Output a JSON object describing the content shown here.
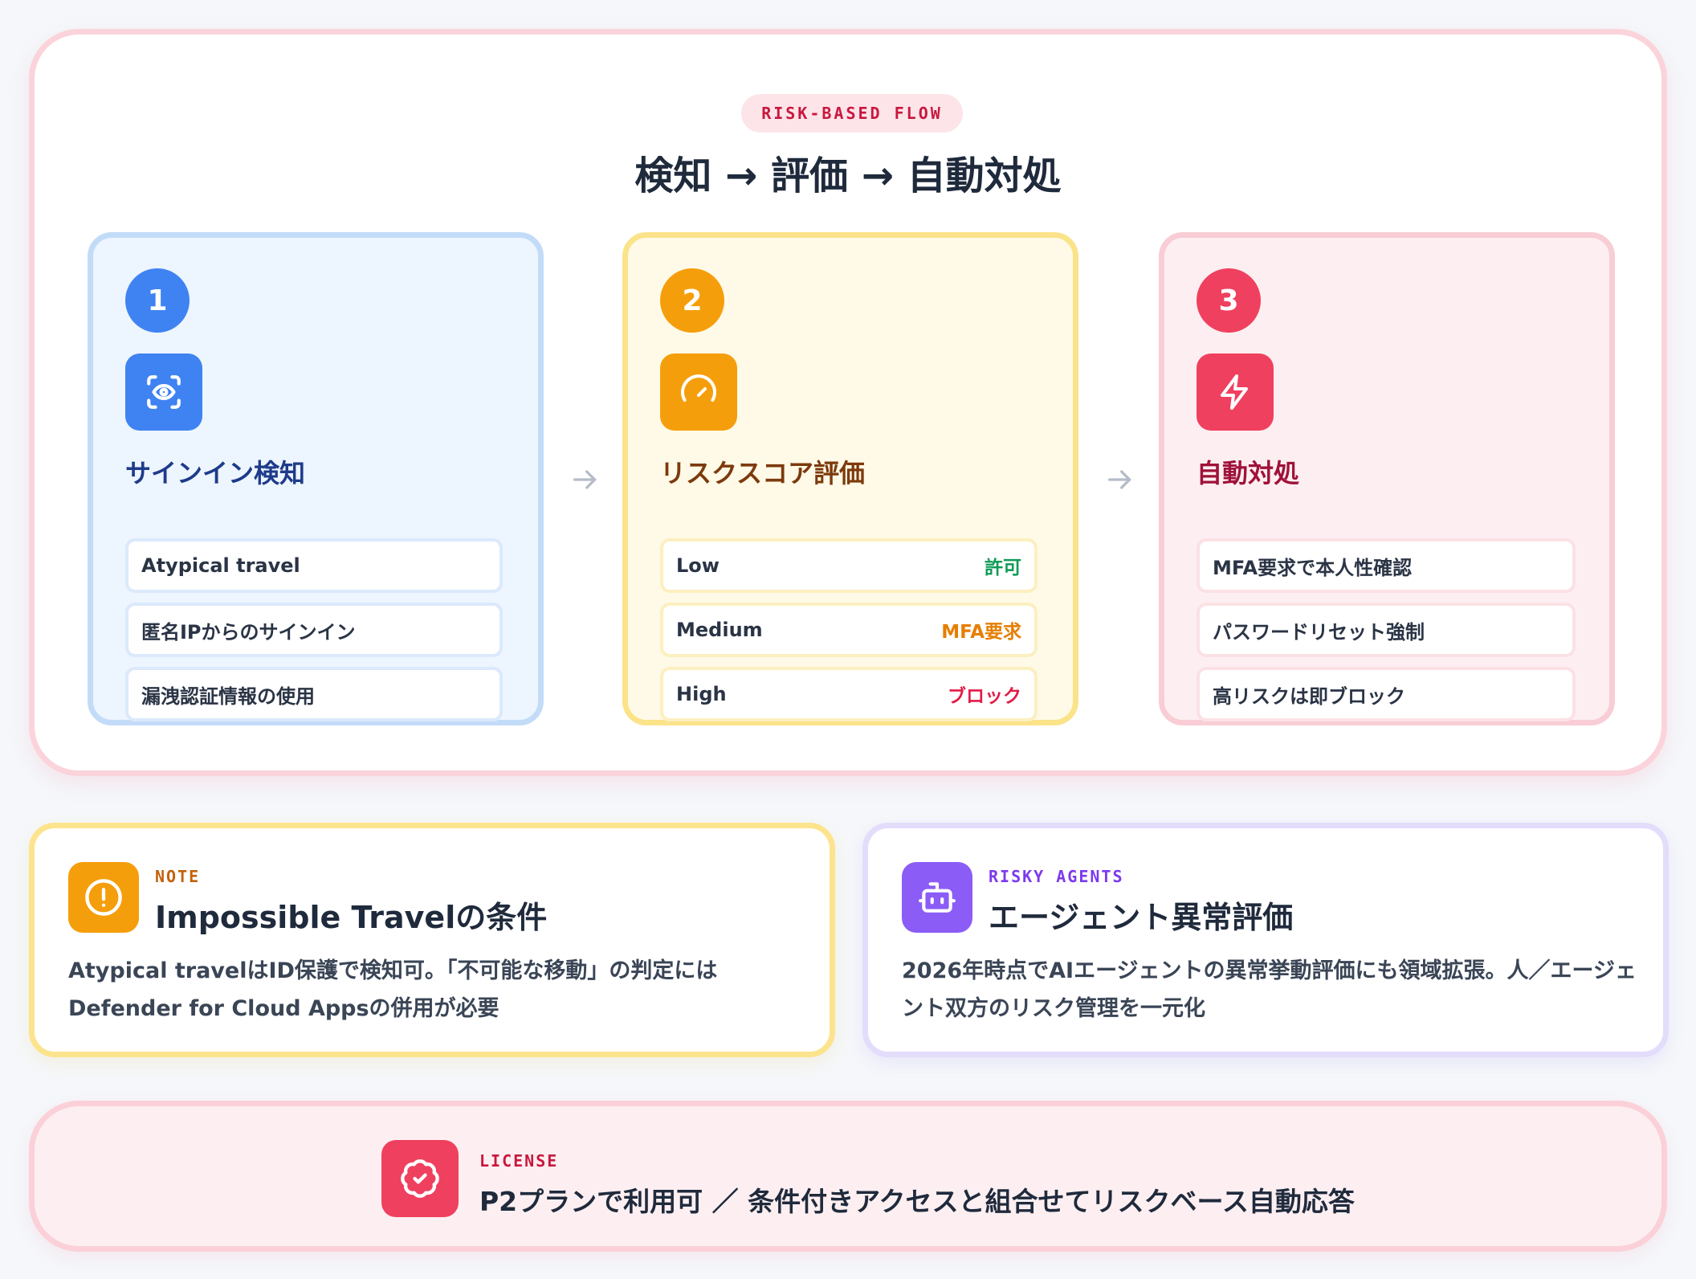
{
  "flow": {
    "pill": "RISK-BASED FLOW",
    "title": "検知 → 評価 → 自動対処",
    "steps": [
      {
        "number": "1",
        "icon": "scan-eye-icon",
        "title": "サインイン検知",
        "items": [
          "Atypical travel",
          "匿名IPからのサインイン",
          "漏洩認証情報の使用"
        ]
      },
      {
        "number": "2",
        "icon": "gauge-icon",
        "title": "リスクスコア評価",
        "levels": [
          {
            "label": "Low",
            "action": "許可"
          },
          {
            "label": "Medium",
            "action": "MFA要求"
          },
          {
            "label": "High",
            "action": "ブロック"
          }
        ]
      },
      {
        "number": "3",
        "icon": "lightning-icon",
        "title": "自動対処",
        "items": [
          "MFA要求で本人性確認",
          "パスワードリセット強制",
          "高リスクは即ブロック"
        ]
      }
    ]
  },
  "note": {
    "icon": "alert-circle-icon",
    "kicker": "NOTE",
    "title": "Impossible Travelの条件",
    "body": "Atypical travelはID保護で検知可。「不可能な移動」の判定にはDefender for Cloud Appsの併用が必要"
  },
  "agents": {
    "icon": "robot-icon",
    "kicker": "RISKY AGENTS",
    "title": "エージェント異常評価",
    "body": "2026年時点でAIエージェントの異常挙動評価にも領域拡張。人／エージェント双方のリスク管理を一元化"
  },
  "license": {
    "icon": "badge-check-icon",
    "kicker": "LICENSE",
    "text": "P2プランで利用可 ／ 条件付きアクセスと組合せてリスクベース自動応答"
  },
  "colors": {
    "blue": "#3f83f2",
    "amber": "#f59e0b",
    "red": "#f0405f",
    "purple": "#8b5cf6",
    "allow": "#0f9b57",
    "mfa": "#e67e00",
    "block": "#e11d48"
  }
}
